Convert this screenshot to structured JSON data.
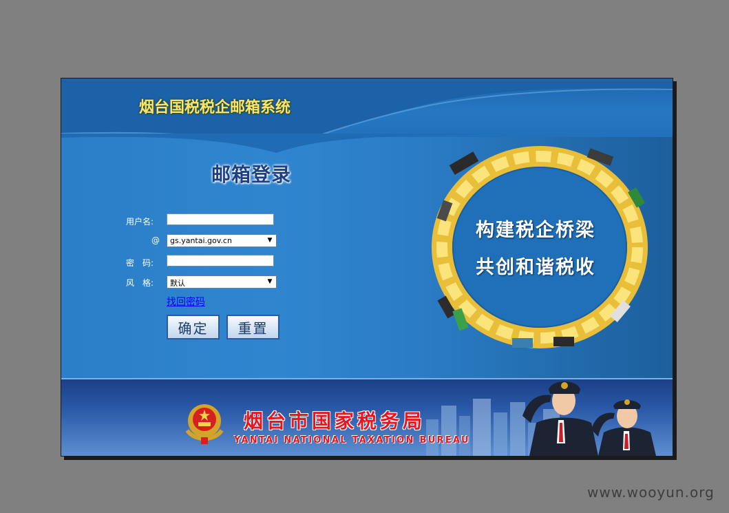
{
  "header": {
    "title": "烟台国税税企邮箱系统"
  },
  "login": {
    "title": "邮箱登录",
    "username_label": "用户名:",
    "username_value": "",
    "domain_label": "@",
    "domain_value": "gs.yantai.gov.cn",
    "password_label": "密　码:",
    "password_value": "",
    "style_label": "风　格:",
    "style_value": "默认",
    "forgot_link": "找回密码",
    "submit_label": "确定",
    "reset_label": "重置"
  },
  "slogan": {
    "line1": "构建税企桥梁",
    "line2": "共创和谐税收"
  },
  "footer": {
    "bureau_cn": "烟台市国家税务局",
    "bureau_en": "YANTAI NATIONAL TAXATION BUREAU"
  },
  "watermark": "www.wooyun.org",
  "colors": {
    "page_bg": "#808080",
    "panel_blue": "#2a78c0",
    "title_yellow": "#ffe36a",
    "bureau_red": "#e8151f",
    "button_border": "#2c5aa0"
  },
  "icons": {
    "select_arrow": "chevron-down-icon",
    "emblem": "national-emblem-icon"
  }
}
